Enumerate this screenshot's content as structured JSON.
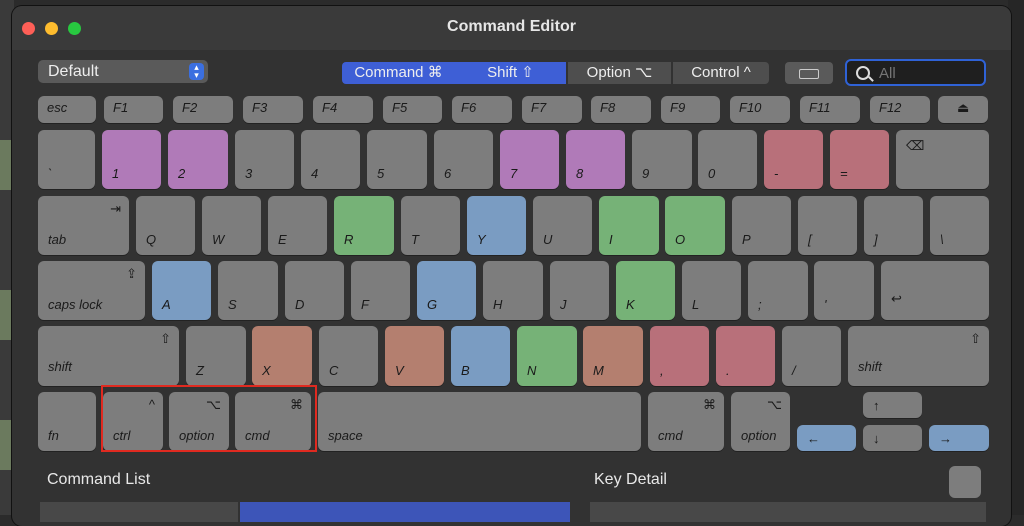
{
  "window": {
    "title": "Command Editor"
  },
  "toolbar": {
    "preset": "Default",
    "modifiers": [
      "Command ⌘",
      "Shift ⇧",
      "Option ⌥",
      "Control ^"
    ],
    "search_placeholder": "All"
  },
  "keyboard": {
    "fn_row": [
      "esc",
      "F1",
      "F2",
      "F3",
      "F4",
      "F5",
      "F6",
      "F7",
      "F8",
      "F9",
      "F10",
      "F11",
      "F12",
      "⏏"
    ],
    "number_row": [
      "`",
      "1",
      "2",
      "3",
      "4",
      "5",
      "6",
      "7",
      "8",
      "9",
      "0",
      "-",
      "=",
      "⌫"
    ],
    "qwerty_row": [
      "tab",
      "Q",
      "W",
      "E",
      "R",
      "T",
      "Y",
      "U",
      "I",
      "O",
      "P",
      "[",
      "]",
      "\\"
    ],
    "tab_symbol": "⇥",
    "home_row": [
      "caps lock",
      "A",
      "S",
      "D",
      "F",
      "G",
      "H",
      "J",
      "K",
      "L",
      ";",
      "'",
      "↩"
    ],
    "caps_symbol": "⇪",
    "shift_row": [
      "shift",
      "Z",
      "X",
      "C",
      "V",
      "B",
      "N",
      "M",
      ",",
      ".",
      "/",
      "shift"
    ],
    "shift_symbol": "⇧",
    "bottom_row": [
      "fn",
      "ctrl",
      "option",
      "cmd",
      "space",
      "cmd",
      "option"
    ],
    "ctrl_symbol": "^",
    "option_symbol": "⌥",
    "cmd_symbol": "⌘",
    "arrows": {
      "left": "←",
      "up": "↑",
      "down": "↓",
      "right": "→"
    }
  },
  "colors": {
    "purple": "#b07ab8",
    "red": "#b8707a",
    "green": "#76b277",
    "blue": "#7a9cc2",
    "orange": "#b47f6f",
    "highlight": "#e02a20",
    "accent": "#3e5fd6"
  },
  "sections": {
    "command_list": "Command List",
    "key_detail": "Key Detail"
  }
}
